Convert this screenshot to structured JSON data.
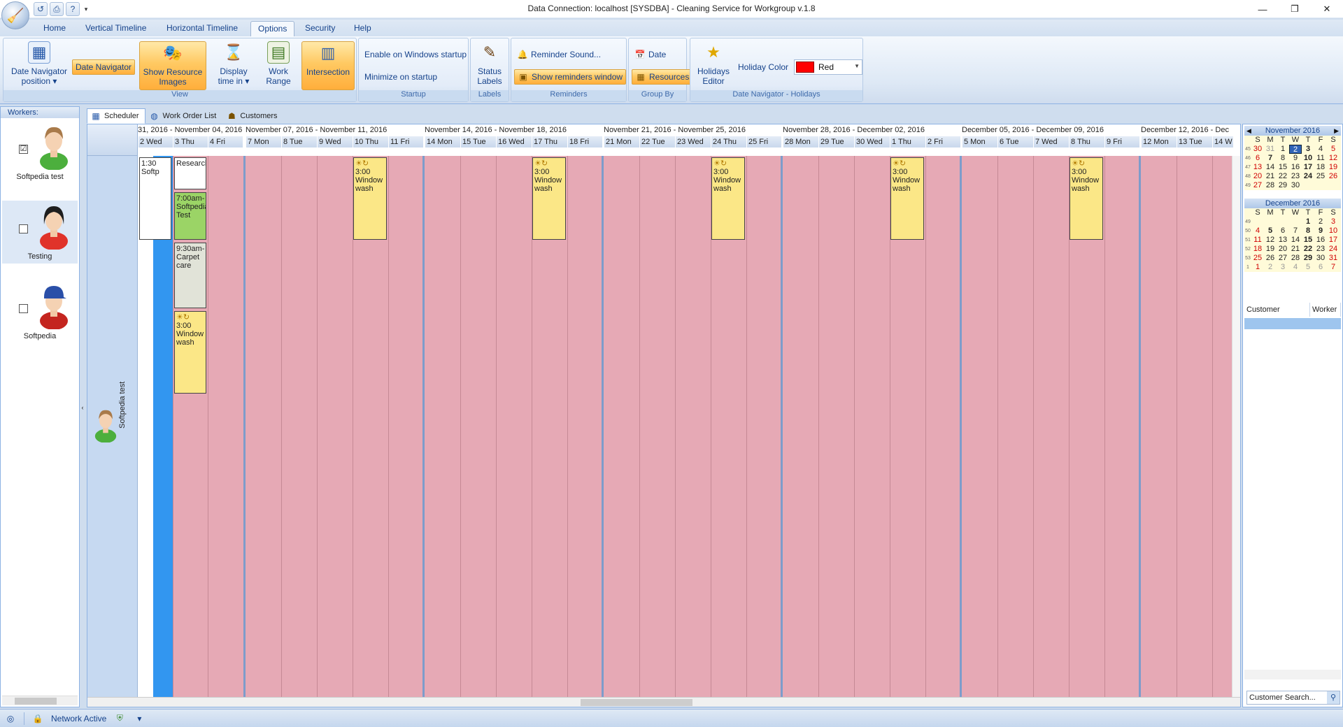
{
  "window": {
    "title": "Data Connection: localhost [SYSDBA] - Cleaning Service for Workgroup v.1.8",
    "controls": [
      "—",
      "❐",
      "✕"
    ]
  },
  "quick_access": [
    "back-icon",
    "print-icon",
    "help-icon"
  ],
  "ribbon_tabs": [
    "Home",
    "Vertical Timeline",
    "Horizontal Timeline",
    "Options",
    "Security",
    "Help"
  ],
  "active_tab": "Options",
  "ribbon": {
    "view": {
      "caption": "View",
      "date_nav_position": "Date Navigator position ▾",
      "date_navigator": "Date Navigator",
      "show_resource_images": "Show Resource Images",
      "display_time_in": "Display time in ▾",
      "work_range": "Work Range",
      "intersection": "Intersection"
    },
    "startup": {
      "caption": "Startup",
      "enable_windows_startup": "Enable on Windows startup",
      "minimize_on_startup": "Minimize on startup"
    },
    "labels": {
      "caption": "Labels",
      "status_labels": "Status Labels"
    },
    "reminders": {
      "caption": "Reminders",
      "reminder_sound": "Reminder Sound...",
      "show_reminders_window": "Show reminders window"
    },
    "group_by": {
      "caption": "Group By",
      "date": "Date",
      "resources": "Resources"
    },
    "holidays": {
      "caption": "Date Navigator - Holidays",
      "holidays_editor": "Holidays Editor",
      "holiday_color_label": "Holiday Color",
      "holiday_color_value": "Red",
      "holiday_color_hex": "#ff0000"
    }
  },
  "workers": {
    "header": "Workers:",
    "items": [
      {
        "name": "Softpedia test",
        "checked": "☑",
        "selected": false
      },
      {
        "name": "Testing",
        "checked": "",
        "selected": true
      },
      {
        "name": "Softpedia",
        "checked": "",
        "selected": false
      }
    ]
  },
  "view_tabs": [
    "Scheduler",
    "Work Order List",
    "Customers"
  ],
  "active_view_tab": "Scheduler",
  "scheduler": {
    "resource": "Softpedia test",
    "weeks": [
      "31, 2016 - November 04, 2016",
      "November 07, 2016 - November 11, 2016",
      "November 14, 2016 - November 18, 2016",
      "November 21, 2016 - November 25, 2016",
      "November 28, 2016 - December 02, 2016",
      "December 05, 2016 - December 09, 2016",
      "December 12, 2016 - Dec"
    ],
    "days": [
      [
        "2 Wed",
        "3 Thu",
        "4 Fri"
      ],
      [
        "7 Mon",
        "8 Tue",
        "9 Wed",
        "10 Thu",
        "11 Fri"
      ],
      [
        "14 Mon",
        "15 Tue",
        "16 Wed",
        "17 Thu",
        "18 Fri"
      ],
      [
        "21 Mon",
        "22 Tue",
        "23 Wed",
        "24 Thu",
        "25 Fri"
      ],
      [
        "28 Mon",
        "29 Tue",
        "30 Wed",
        "1 Thu",
        "2 Fri"
      ],
      [
        "5 Mon",
        "6 Tue",
        "7 Wed",
        "8 Thu",
        "9 Fri"
      ],
      [
        "12 Mon",
        "13 Tue",
        "14 W"
      ]
    ],
    "appointments": [
      {
        "time": "1:30",
        "text": "Softp",
        "color": "white"
      },
      {
        "time": "",
        "text": "Research",
        "color": "white"
      },
      {
        "time": "7:00am-",
        "text": "Softpedia Test",
        "color": "green"
      },
      {
        "time": "9:30am-",
        "text": "Carpet care",
        "color": "gray"
      },
      {
        "time": "3:00",
        "text": "Window wash",
        "color": "yellow"
      },
      {
        "time": "3:00",
        "text": "Window wash",
        "color": "yellow"
      },
      {
        "time": "3:00",
        "text": "Window wash",
        "color": "yellow"
      },
      {
        "time": "3:00",
        "text": "Window wash",
        "color": "yellow"
      },
      {
        "time": "3:00",
        "text": "Window wash",
        "color": "yellow"
      },
      {
        "time": "3:00",
        "text": "Window wash",
        "color": "yellow"
      }
    ]
  },
  "mini_calendars": [
    {
      "title": "November 2016",
      "weekdays": [
        "S",
        "M",
        "T",
        "W",
        "T",
        "F",
        "S"
      ],
      "weeks": [
        "45",
        "46",
        "47",
        "48",
        "49"
      ],
      "rows": [
        [
          "30",
          "31",
          "1",
          "2",
          "3",
          "4",
          "5"
        ],
        [
          "6",
          "7",
          "8",
          "9",
          "10",
          "11",
          "12"
        ],
        [
          "13",
          "14",
          "15",
          "16",
          "17",
          "18",
          "19"
        ],
        [
          "20",
          "21",
          "22",
          "23",
          "24",
          "25",
          "26"
        ],
        [
          "27",
          "28",
          "29",
          "30",
          "",
          "",
          ""
        ]
      ]
    },
    {
      "title": "December 2016",
      "weekdays": [
        "S",
        "M",
        "T",
        "W",
        "T",
        "F",
        "S"
      ],
      "weeks": [
        "49",
        "50",
        "51",
        "52",
        "53",
        "1"
      ],
      "rows": [
        [
          "",
          "",
          "",
          "",
          "1",
          "2",
          "3"
        ],
        [
          "4",
          "5",
          "6",
          "7",
          "8",
          "9",
          "10"
        ],
        [
          "11",
          "12",
          "13",
          "14",
          "15",
          "16",
          "17"
        ],
        [
          "18",
          "19",
          "20",
          "21",
          "22",
          "23",
          "24"
        ],
        [
          "25",
          "26",
          "27",
          "28",
          "29",
          "30",
          "31"
        ],
        [
          "1",
          "2",
          "3",
          "4",
          "5",
          "6",
          "7"
        ]
      ]
    }
  ],
  "customer_grid": {
    "columns": [
      "Customer",
      "Worker"
    ]
  },
  "customer_search": {
    "placeholder": "Customer Search..."
  },
  "statusbar": {
    "network": "Network Active"
  }
}
